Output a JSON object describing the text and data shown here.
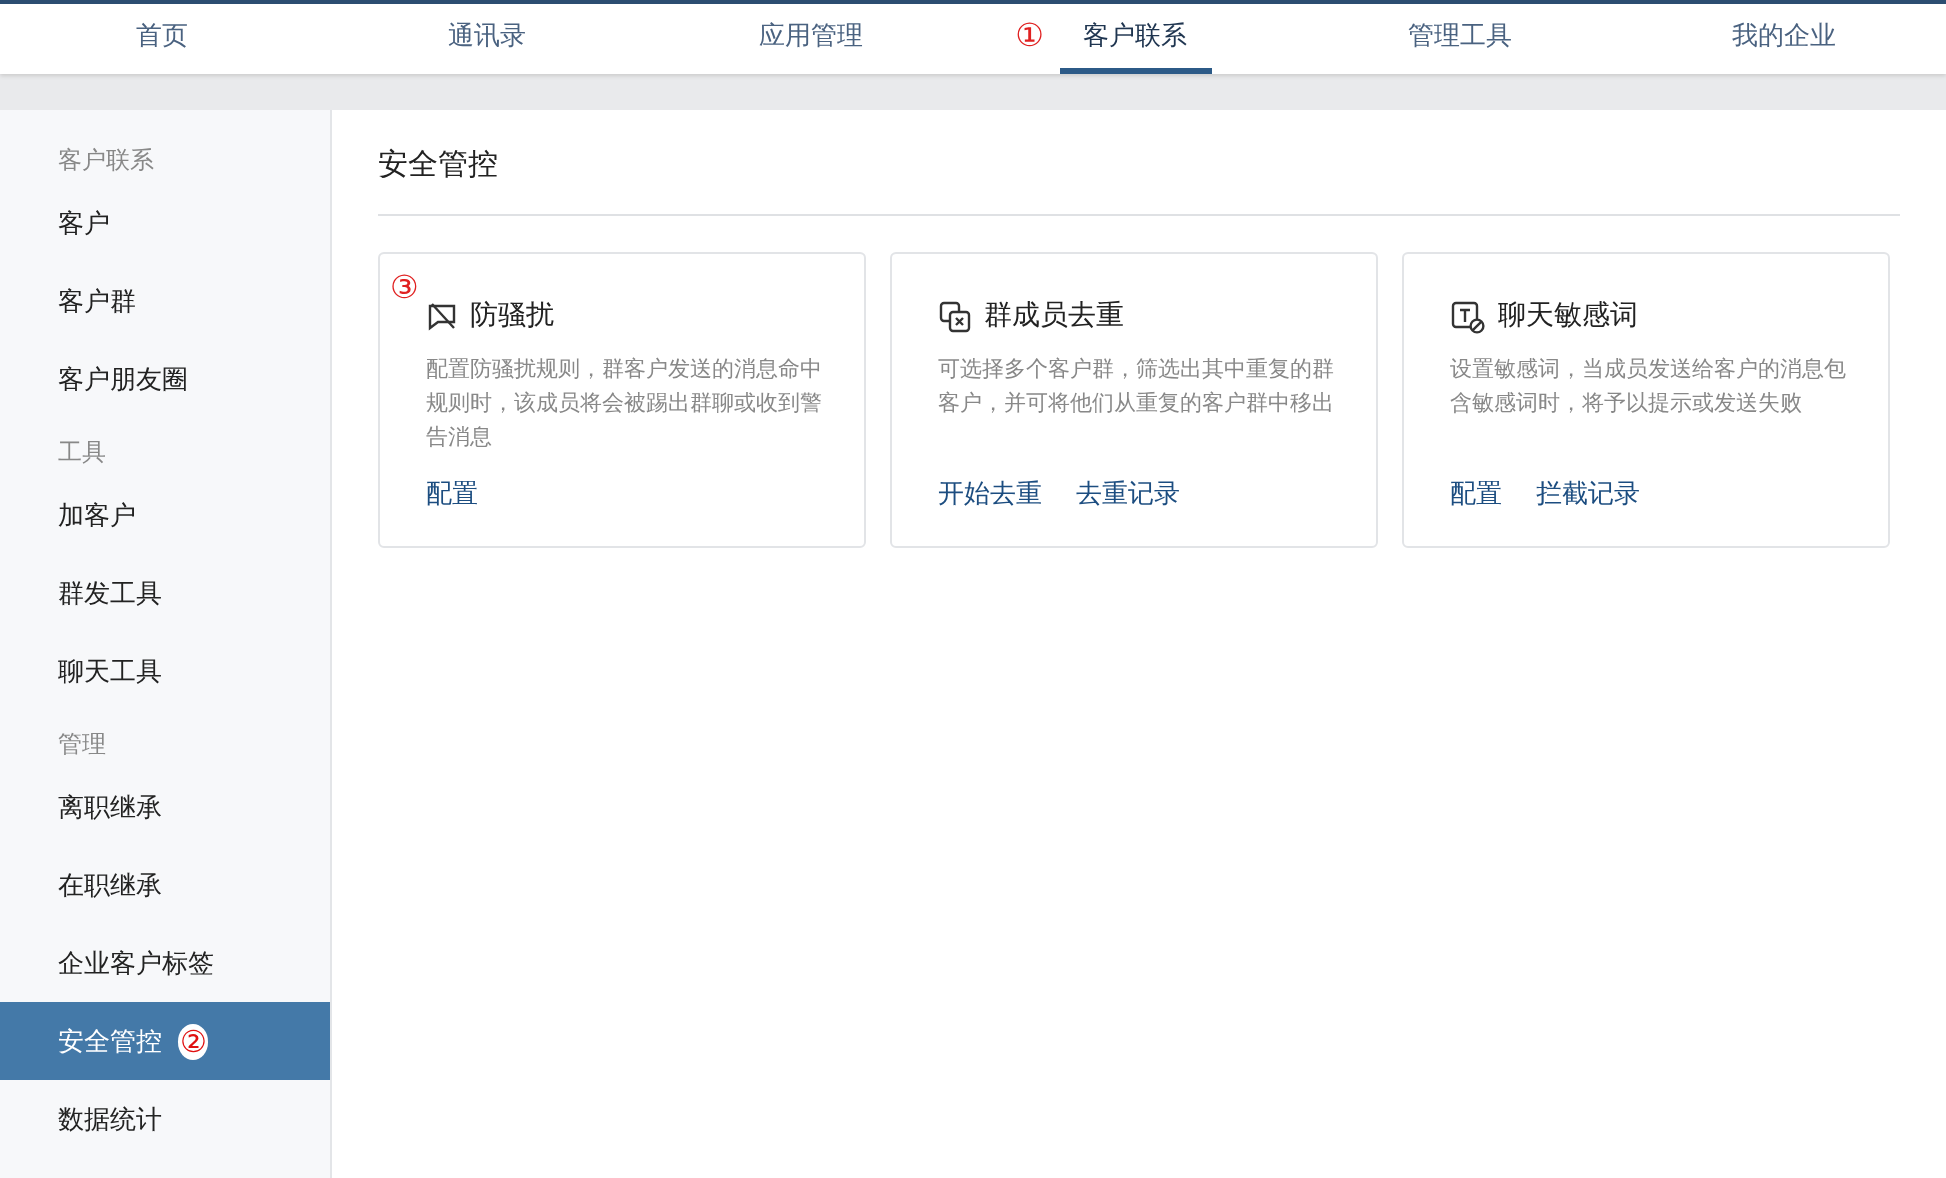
{
  "top_nav": {
    "tabs": [
      {
        "label": "首页",
        "selected": false
      },
      {
        "label": "通讯录",
        "selected": false
      },
      {
        "label": "应用管理",
        "selected": false
      },
      {
        "label": "客户联系",
        "selected": true,
        "annotation": "①"
      },
      {
        "label": "管理工具",
        "selected": false
      },
      {
        "label": "我的企业",
        "selected": false
      }
    ]
  },
  "sidebar": {
    "groups": [
      {
        "heading": "客户联系",
        "items": [
          {
            "label": "客户",
            "selected": false
          },
          {
            "label": "客户群",
            "selected": false
          },
          {
            "label": "客户朋友圈",
            "selected": false
          }
        ]
      },
      {
        "heading": "工具",
        "items": [
          {
            "label": "加客户",
            "selected": false
          },
          {
            "label": "群发工具",
            "selected": false
          },
          {
            "label": "聊天工具",
            "selected": false
          }
        ]
      },
      {
        "heading": "管理",
        "items": [
          {
            "label": "离职继承",
            "selected": false
          },
          {
            "label": "在职继承",
            "selected": false
          },
          {
            "label": "企业客户标签",
            "selected": false
          },
          {
            "label": "安全管控",
            "selected": true,
            "annotation": "②"
          },
          {
            "label": "数据统计",
            "selected": false
          }
        ]
      }
    ]
  },
  "main": {
    "title": "安全管控",
    "cards": [
      {
        "kind": "harass",
        "annotation": "③",
        "title": "防骚扰",
        "description": "配置防骚扰规则，群客户发送的消息命中规则时，该成员将会被踢出群聊或收到警告消息",
        "links": [
          "配置"
        ]
      },
      {
        "kind": "dedupe",
        "title": "群成员去重",
        "description": "可选择多个客户群，筛选出其中重复的群客户，并可将他们从重复的客户群中移出",
        "links": [
          "开始去重",
          "去重记录"
        ]
      },
      {
        "kind": "sensitive",
        "title": "聊天敏感词",
        "description": "设置敏感词，当成员发送给客户的消息包含敏感词时，将予以提示或发送失败",
        "links": [
          "配置",
          "拦截记录"
        ]
      }
    ]
  }
}
